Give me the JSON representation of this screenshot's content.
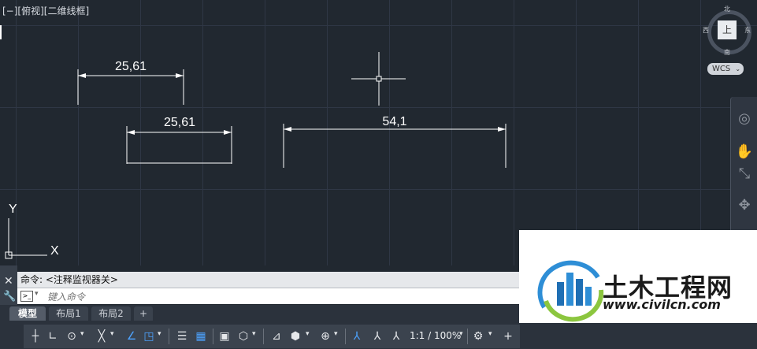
{
  "viewport": {
    "label": "[−][俯视][二维线框]"
  },
  "dimensions": [
    {
      "value": "25,61"
    },
    {
      "value": "25,61"
    },
    {
      "value": "54,1"
    }
  ],
  "ucs": {
    "x_label": "X",
    "y_label": "Y"
  },
  "viewcube": {
    "north": "北",
    "south": "南",
    "east": "东",
    "west": "西",
    "face": "上"
  },
  "wcs_button": {
    "label": "WCS"
  },
  "command_line": {
    "history": "命令: <注释监视器关>",
    "placeholder": "键入命令"
  },
  "layout_tabs": [
    {
      "label": "模型",
      "active": true
    },
    {
      "label": "布局1",
      "active": false
    },
    {
      "label": "布局2",
      "active": false
    },
    {
      "label": "+",
      "active": false
    }
  ],
  "status_bar": {
    "scale": "1:1 / 100%"
  },
  "watermark": {
    "title": "土木工程网",
    "url": "www.civilcn.com"
  },
  "colors": {
    "canvas": "#212830",
    "grid": "#2f3745",
    "accent": "#4da3ff"
  }
}
